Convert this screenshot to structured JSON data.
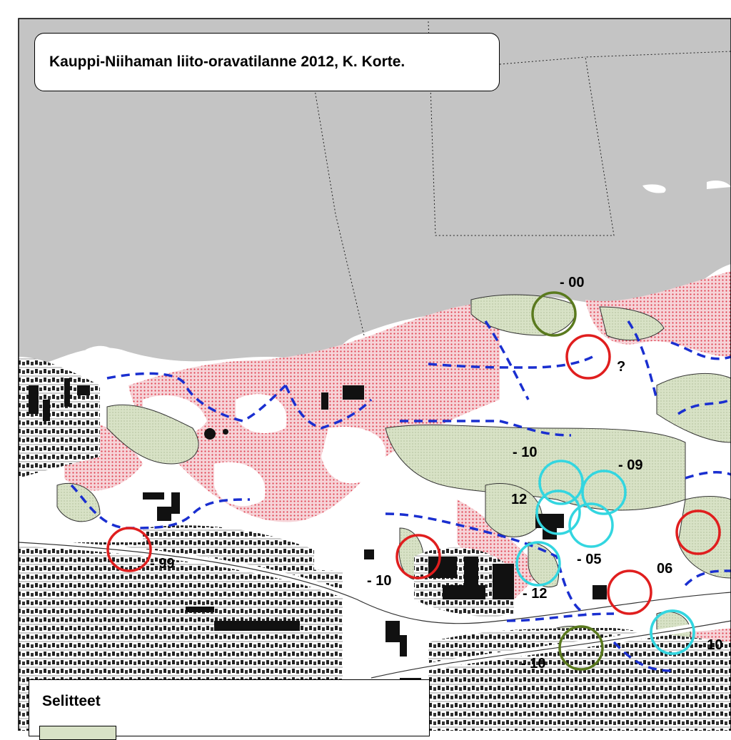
{
  "title": "Kauppi-Niihaman liito-oravatilanne 2012, K. Korte.",
  "legend": {
    "heading": "Selitteet"
  },
  "colors": {
    "water": "#c4c4c4",
    "habitat_green": "#d8e2c6",
    "pink_dots": "#e04050",
    "boundary_dash": "#1a2fd0",
    "circle_red": "#e01e1e",
    "circle_cyan": "#33d6e0",
    "circle_green": "#5a7a1e"
  },
  "labels": {
    "y00": "- 00",
    "question": "?",
    "y10a": "- 10",
    "y09": "- 09",
    "y12a": "12",
    "y99": "- 99",
    "y10b": "- 10",
    "y05": "- 05",
    "y06": "06",
    "y12b": "- 12",
    "y10c": "- 10",
    "y10d": "- 10"
  },
  "map_marks": {
    "circles": [
      {
        "type": "green"
      },
      {
        "type": "red"
      },
      {
        "type": "red"
      },
      {
        "type": "red"
      },
      {
        "type": "red"
      },
      {
        "type": "red"
      },
      {
        "type": "cyan"
      },
      {
        "type": "cyan"
      },
      {
        "type": "cyan"
      },
      {
        "type": "cyan"
      },
      {
        "type": "cyan"
      },
      {
        "type": "cyan"
      },
      {
        "type": "cyan"
      },
      {
        "type": "green"
      }
    ]
  }
}
